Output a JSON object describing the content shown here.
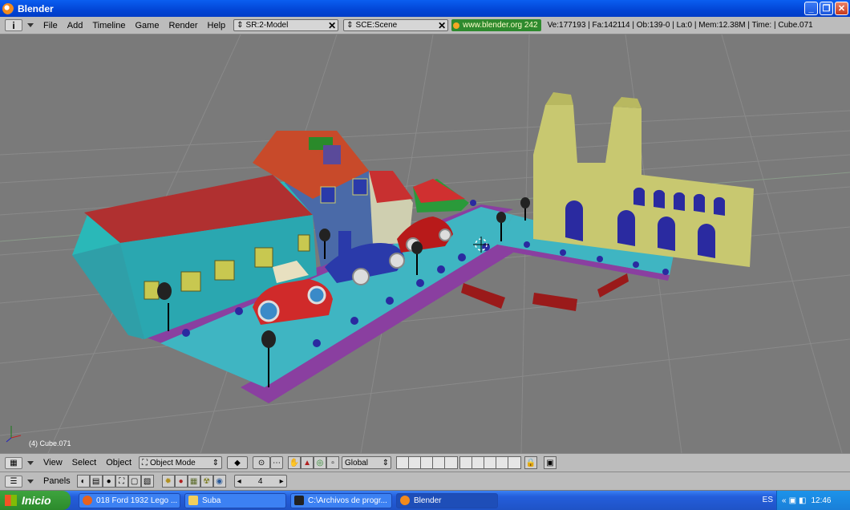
{
  "window": {
    "title": "Blender",
    "minimize": "_",
    "maximize": "❐",
    "close": "✕"
  },
  "header": {
    "menus": [
      "File",
      "Add",
      "Timeline",
      "Game",
      "Render",
      "Help"
    ],
    "screen_field": "SR:2-Model",
    "scene_field": "SCE:Scene",
    "url": "www.blender.org 242",
    "stats": "Ve:177193 | Fa:142114 | Ob:139-0 | La:0  | Mem:12.38M  | Time:  | Cube.071"
  },
  "viewport": {
    "object_label": "(4) Cube.071"
  },
  "view_header": {
    "menus": [
      "View",
      "Select",
      "Object"
    ],
    "mode": "Object Mode",
    "orientation": "Global"
  },
  "buttons_header": {
    "label": "Panels",
    "frame": "4"
  },
  "taskbar": {
    "start": "Inicio",
    "items": [
      {
        "label": "018 Ford 1932 Lego ...",
        "icon_color": "#e8621c"
      },
      {
        "label": "Suba",
        "icon_color": "#f2cf5b"
      },
      {
        "label": "C:\\Archivos de progr...",
        "icon_color": "#222222"
      },
      {
        "label": "Blender",
        "icon_color": "#f28a1c"
      }
    ],
    "language": "ES",
    "clock": "12:46"
  }
}
